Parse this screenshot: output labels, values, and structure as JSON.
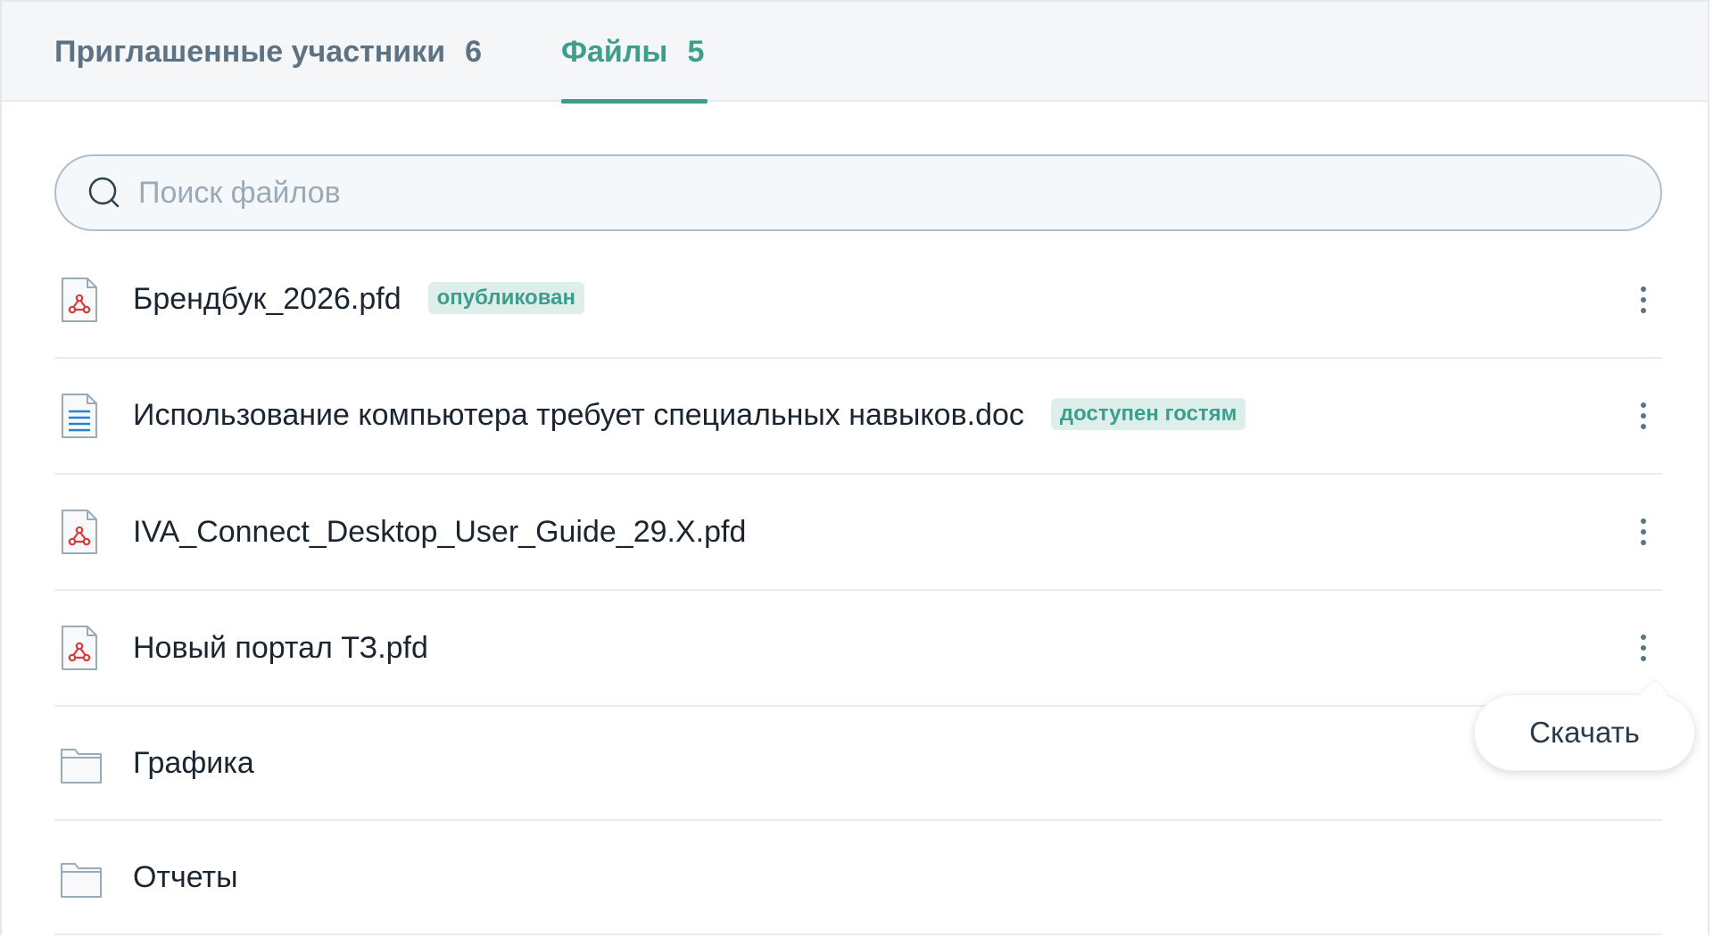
{
  "tabs": [
    {
      "label": "Приглашенные участники",
      "count": "6"
    },
    {
      "label": "Файлы",
      "count": "5"
    }
  ],
  "search": {
    "placeholder": "Поиск файлов",
    "icon": "search-icon"
  },
  "files": [
    {
      "name": "Брендбук_2026.pfd",
      "badge": "опубликован",
      "icon": "pdf-file-icon"
    },
    {
      "name": "Использование компьютера требует специальных навыков.doc",
      "badge": "доступен гостям",
      "icon": "doc-file-icon"
    },
    {
      "name": "IVA_Connect_Desktop_User_Guide_29.X.pfd",
      "icon": "pdf-file-icon"
    },
    {
      "name": "Новый портал ТЗ.pfd",
      "icon": "pdf-file-icon"
    },
    {
      "name": "Графика",
      "icon": "folder-icon"
    },
    {
      "name": "Отчеты",
      "icon": "folder-icon"
    }
  ],
  "context_menu": {
    "download_label": "Скачать"
  },
  "colors": {
    "accent": "#3d9e8c",
    "badge_bg": "#deefeb",
    "tab_inactive": "#5d7282",
    "pdf_red": "#d93a3a",
    "doc_blue": "#2f7fd0"
  }
}
